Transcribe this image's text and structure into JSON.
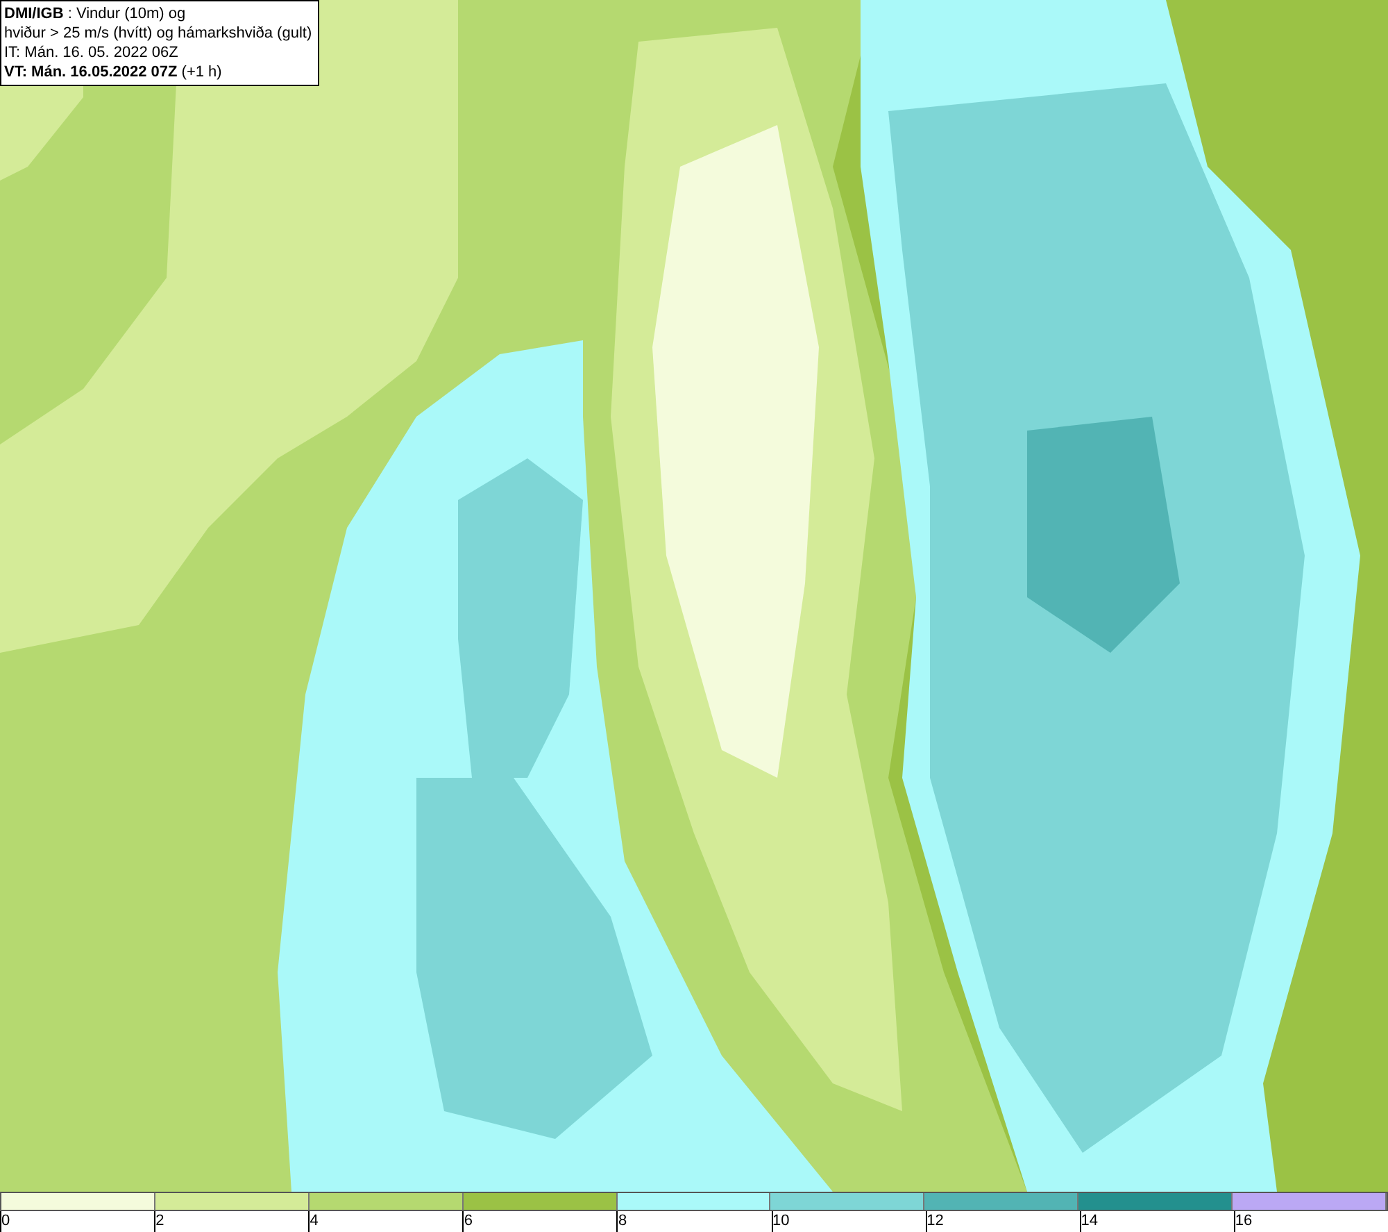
{
  "map": {
    "title_lines": [
      "**DMI/IGB** : Vindur (10m) og",
      "hviður > 25 m/s (hvítt) og hámarkshviða (gult)",
      "IT: Mán. 16. 05. 2022 06Z",
      "**VT: Mán. 16.05.2022 07Z** (+1 h)"
    ]
  },
  "legend": {
    "segments": [
      {
        "color": "#f4fbdc",
        "label": "0"
      },
      {
        "color": "#d4eb98",
        "label": "2"
      },
      {
        "color": "#b5d970",
        "label": "4"
      },
      {
        "color": "#9bc245",
        "label": "6"
      },
      {
        "color": "#aaf9f9",
        "label": "8"
      },
      {
        "color": "#7ed6d6",
        "label": "10"
      },
      {
        "color": "#52b4b4",
        "label": "12"
      },
      {
        "color": "#23908e",
        "label": "14"
      },
      {
        "color": "#bba8f4",
        "label": "16"
      }
    ]
  }
}
